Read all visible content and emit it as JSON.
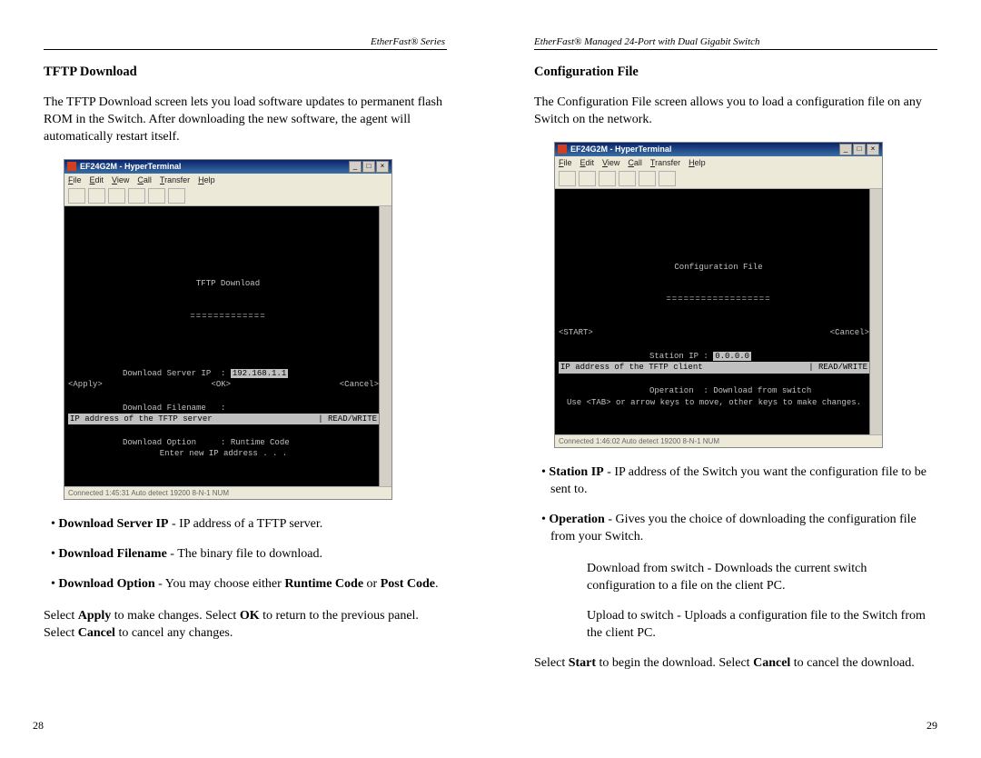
{
  "left": {
    "header": "EtherFast® Series",
    "title": "TFTP Download",
    "intro": "The TFTP Download screen lets you load software updates to permanent flash ROM in the Switch. After downloading the new software, the agent will automatically restart itself.",
    "shot": {
      "win_title": "EF24G2M - HyperTerminal",
      "menu": [
        "File",
        "Edit",
        "View",
        "Call",
        "Transfer",
        "Help"
      ],
      "term_title": "TFTP Download",
      "rule": "=============",
      "f1l": "Download Server IP  : ",
      "f1v": "192.168.1.1",
      "f2": "Download Filename   :",
      "f3": "Download Option     : Runtime Code",
      "btn_apply": "<Apply>",
      "btn_ok": "<OK>",
      "btn_cancel": "<Cancel>",
      "rev_l": "IP address of the TFTP server",
      "rev_r": "| READ/WRITE",
      "last": "Enter new IP address . . .",
      "status": "Connected 1:45:31       Auto detect     19200 8-N-1       NUM"
    },
    "b1_lead": "Download Server IP",
    "b1_rest": " - IP address of a TFTP server.",
    "b2_lead": "Download Filename",
    "b2_rest": " - The binary file to download.",
    "b3_lead": "Download Option",
    "b3_mid": " - You may choose either ",
    "b3_rc": "Runtime Code",
    "b3_or": " or ",
    "b3_pc": "Post Code",
    "b3_end": ".",
    "out_1": "Select ",
    "out_apply": "Apply",
    "out_2": " to make changes. Select ",
    "out_ok": "OK",
    "out_3": " to return to the previous panel. Select ",
    "out_cancel": "Cancel",
    "out_4": " to cancel any changes.",
    "page_no": "28"
  },
  "right": {
    "header": "EtherFast® Managed 24-Port with Dual Gigabit Switch",
    "title": "Configuration File",
    "intro": "The Configuration File screen allows you to load a configuration file on any Switch on the network.",
    "shot": {
      "win_title": "EF24G2M - HyperTerminal",
      "menu": [
        "File",
        "Edit",
        "View",
        "Call",
        "Transfer",
        "Help"
      ],
      "term_title": "Configuration File",
      "rule": "==================",
      "f1l": "Station IP : ",
      "f1v": "0.0.0.0",
      "f2": "Operation  : Download from switch",
      "btn_start": "<START>",
      "btn_cancel": "<Cancel>",
      "rev_l": "IP address of the TFTP client",
      "rev_r": "| READ/WRITE",
      "last": "Use <TAB> or arrow keys to move, other keys to make changes.",
      "status": "Connected 1:46:02       Auto detect     19200 8-N-1       NUM"
    },
    "b1_lead": "Station IP",
    "b1_rest": " - IP address of the Switch you want the configuration file to be sent to.",
    "b2_lead": "Operation",
    "b2_rest": " - Gives you the choice of downloading the configuration file from your Switch.",
    "sub1": "Download from switch - Downloads the current switch configuration to a file on the client PC.",
    "sub2": "Upload to switch - Uploads a configuration file to the Switch from the client PC.",
    "out_1": "Select ",
    "out_start": "Start",
    "out_2": " to begin the download. Select ",
    "out_cancel": "Cancel",
    "out_3": " to cancel the download.",
    "page_no": "29"
  }
}
